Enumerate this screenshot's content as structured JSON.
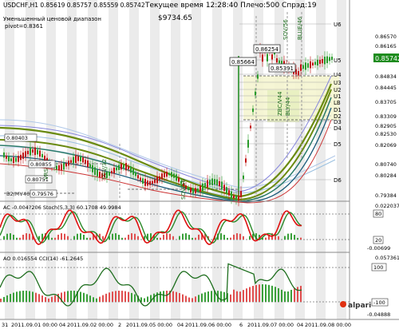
{
  "header": {
    "symbol_line": "USDCHF,H1  0.85619 0.85757 0.85559 0.85742",
    "range_label": "Уменьшенный ценовой диапазон",
    "pivot_label": "pivot=0.8361",
    "status_line": "Текущее время 12:28:40 Плечо:500 Спрэд:19",
    "balance": "$9734.65"
  },
  "price_axis": {
    "labels": [
      "0.86570",
      "0.86165",
      "0.85742",
      "0.84834",
      "0.84445",
      "0.83705",
      "0.83309",
      "0.82905",
      "0.82530",
      "0.82069",
      "0.80740",
      "0.80284",
      "0.79384"
    ],
    "current_color": "#1e8c1e"
  },
  "levels": {
    "labels": [
      "U6",
      "U5",
      "U4",
      "U3",
      "U2",
      "U1",
      "LB",
      "D1",
      "D2",
      "D3",
      "D4",
      "D5",
      "D6"
    ]
  },
  "annotations": {
    "high_box": "0.86254",
    "box_a": "0.85664",
    "box_b": "0.85391",
    "left_a": "0.80855",
    "left_b": "0.80751",
    "left_c": "0.79576",
    "left_top": "0.80403",
    "left_bottom_tag": "B2/MV46",
    "vertical_tags": [
      "SOV/56",
      "BLUE/46",
      "ZBC/V44",
      "BLY/44",
      "SGV/32",
      "VRS",
      "SOV/56"
    ]
  },
  "indicators": {
    "stoch_label": "AC -0.004?206  Stoch(5,3,3) 60.1708 49.9984",
    "stoch_axis": [
      "0.022037",
      "80",
      "20",
      "-0.00699"
    ],
    "cci_label": "AO 0.016554  CCI(14) -61.2645",
    "cci_axis": [
      "0.057361",
      "100",
      "-100",
      "-0.04888"
    ]
  },
  "time_axis": [
    "31",
    "2011.09.01 00:00",
    "04",
    "2011.09.02 00:00",
    "2",
    "2011.09.05 00:00",
    "04",
    "2011.09.06 00:00",
    "6",
    "2011.09.07 00:00",
    "04",
    "2011.09.08 00:00"
  ],
  "brand": "alpari",
  "colors": {
    "up_candle": "#2a9b2a",
    "down_candle": "#c01010",
    "stoch_main": "#e01010",
    "stoch_signal": "#2a8a2a",
    "cci_line": "#1e6e1e",
    "accent": "#d0d84a"
  }
}
